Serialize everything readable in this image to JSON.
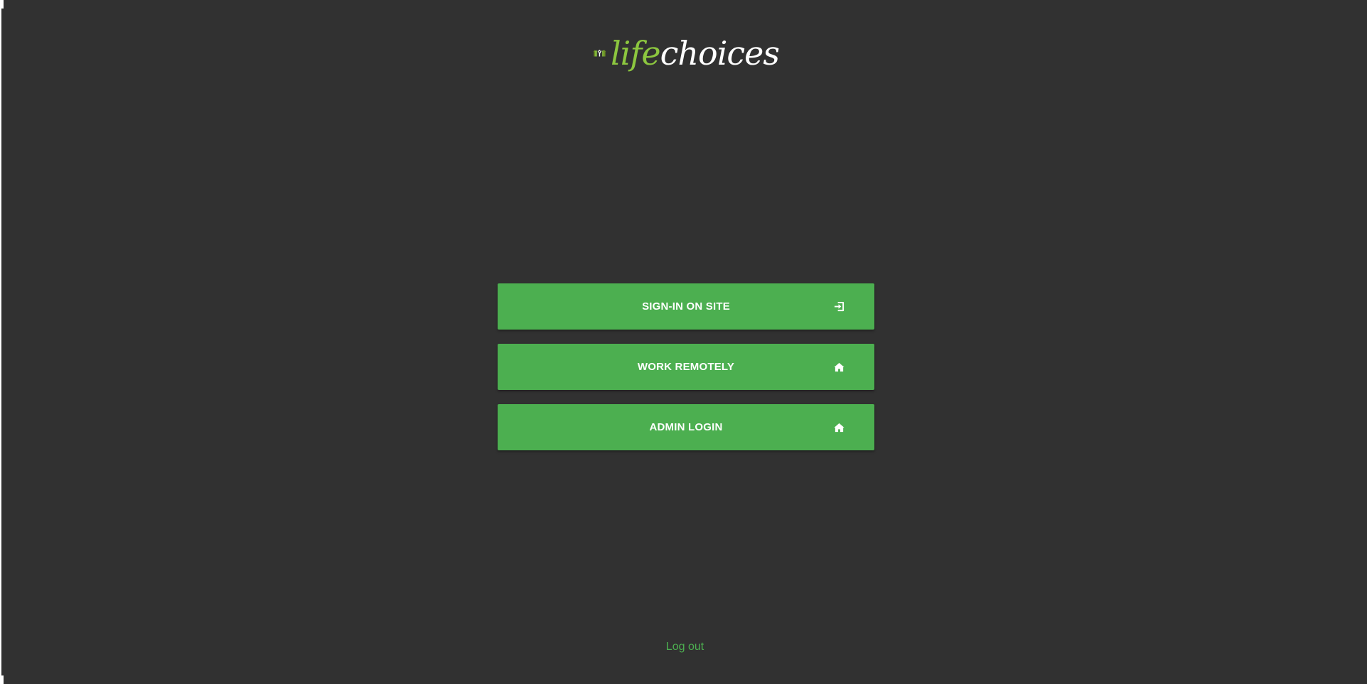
{
  "brand": {
    "logo_part1": "life",
    "logo_part2": "choices",
    "logo_icon": "people-house-icon",
    "colors": {
      "logo_green": "#8cc63f",
      "logo_dark_green": "#6b8e23",
      "logo_white": "#ffffff"
    }
  },
  "actions": [
    {
      "label": "SIGN-IN ON SITE",
      "icon": "sign-in-icon"
    },
    {
      "label": "WORK REMOTELY",
      "icon": "home-icon"
    },
    {
      "label": "ADMIN LOGIN",
      "icon": "home-icon"
    }
  ],
  "footer": {
    "logout_label": "Log out"
  },
  "theme": {
    "background": "#313131",
    "button_color": "#4caf50",
    "button_text": "#ffffff",
    "link_color": "#4caf50"
  }
}
